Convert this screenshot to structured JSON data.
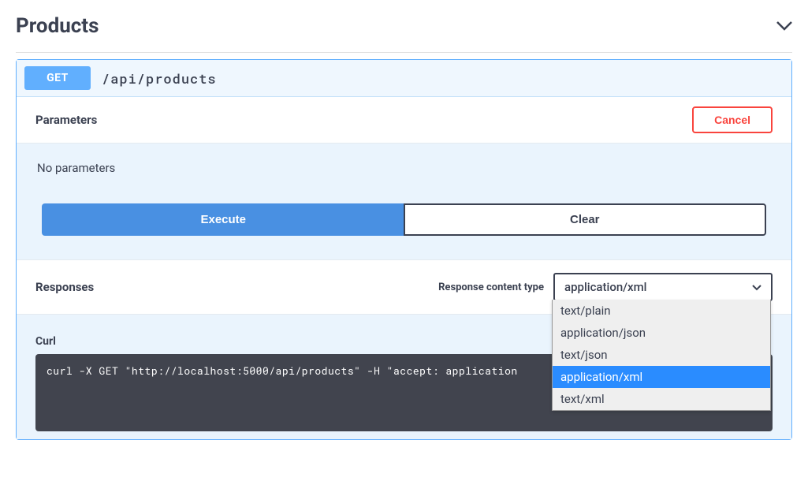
{
  "section": {
    "title": "Products"
  },
  "operation": {
    "method": "GET",
    "path": "/api/products"
  },
  "parameters": {
    "title": "Parameters",
    "cancel": "Cancel",
    "empty": "No parameters"
  },
  "actions": {
    "execute": "Execute",
    "clear": "Clear"
  },
  "responses": {
    "title": "Responses",
    "contentTypeLabel": "Response content type",
    "selected": "application/xml",
    "options": [
      "text/plain",
      "application/json",
      "text/json",
      "application/xml",
      "text/xml"
    ],
    "highlighted": "application/xml"
  },
  "curl": {
    "title": "Curl",
    "command": "curl -X GET \"http://localhost:5000/api/products\" -H \"accept: application"
  }
}
